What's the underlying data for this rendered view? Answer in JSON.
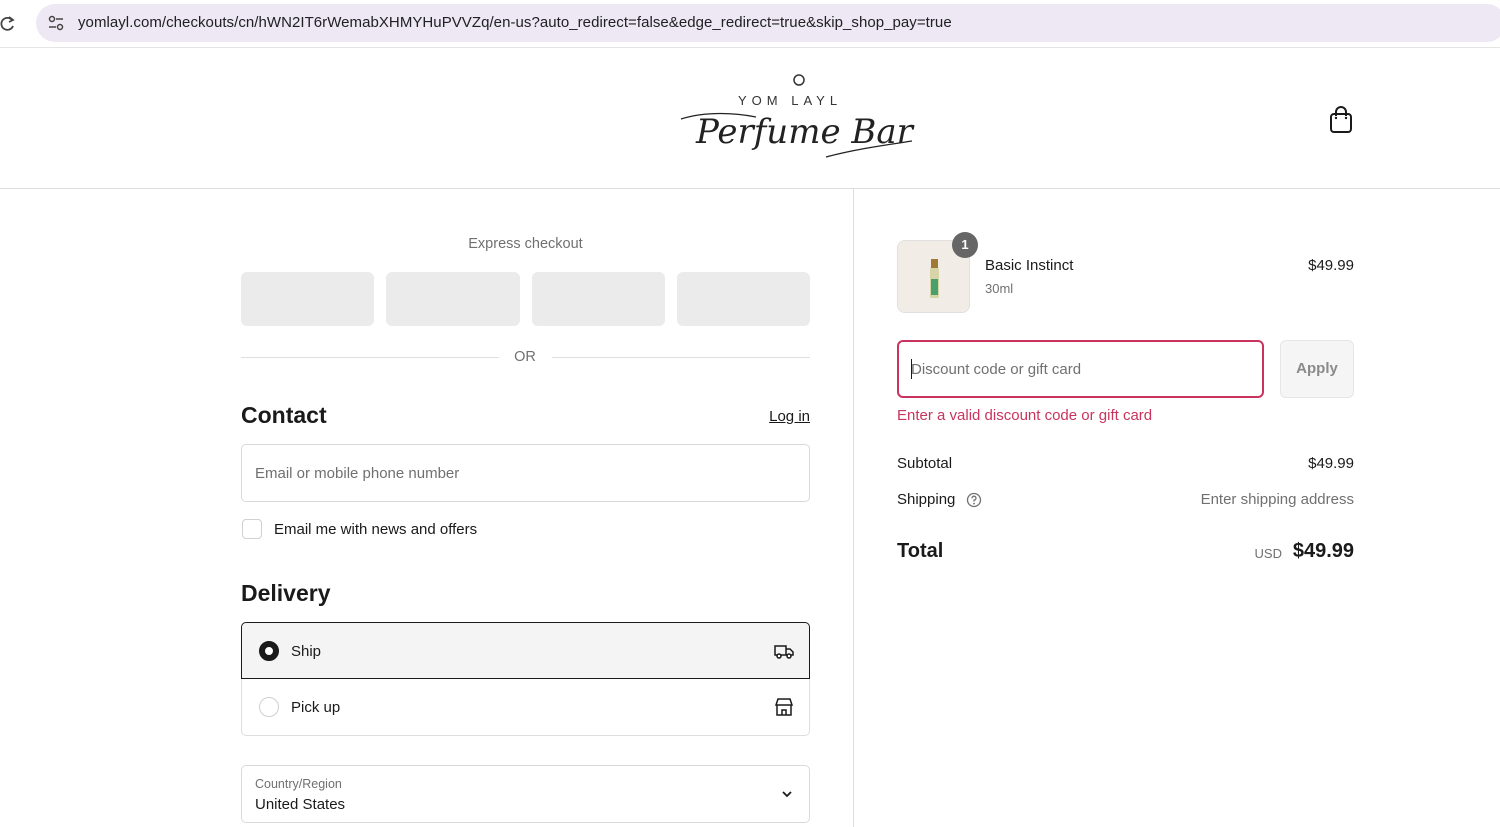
{
  "browser": {
    "url": "yomlayl.com/checkouts/cn/hWN2IT6rWemabXHMYHuPVVZq/en-us?auto_redirect=false&edge_redirect=true&skip_shop_pay=true"
  },
  "header": {
    "logo_top_text": "YOM LAYL",
    "logo_amp": "&",
    "logo_script_text": "Perfume Bar",
    "cart_icon": "shopping-bag-icon"
  },
  "express": {
    "title": "Express checkout",
    "buttons_count": 4,
    "or_label": "OR"
  },
  "contact": {
    "heading": "Contact",
    "login_label": "Log in",
    "email_placeholder": "Email or mobile phone number",
    "newsletter_label": "Email me with news and offers",
    "newsletter_checked": false
  },
  "delivery": {
    "heading": "Delivery",
    "options": [
      {
        "label": "Ship",
        "selected": true,
        "icon": "truck-icon"
      },
      {
        "label": "Pick up",
        "selected": false,
        "icon": "store-icon"
      }
    ],
    "country_label": "Country/Region",
    "country_value": "United States"
  },
  "summary": {
    "item": {
      "name": "Basic Instinct",
      "variant": "30ml",
      "price": "$49.99",
      "quantity": "1"
    },
    "discount_placeholder": "Discount code or gift card",
    "apply_label": "Apply",
    "discount_error": "Enter a valid discount code or gift card",
    "subtotal_label": "Subtotal",
    "subtotal_value": "$49.99",
    "shipping_label": "Shipping",
    "shipping_value": "Enter shipping address",
    "total_label": "Total",
    "total_currency": "USD",
    "total_value": "$49.99"
  },
  "colors": {
    "error": "#c8345e",
    "text": "#1a1a1a",
    "muted": "#707070",
    "url_bar": "#ede8f3"
  }
}
